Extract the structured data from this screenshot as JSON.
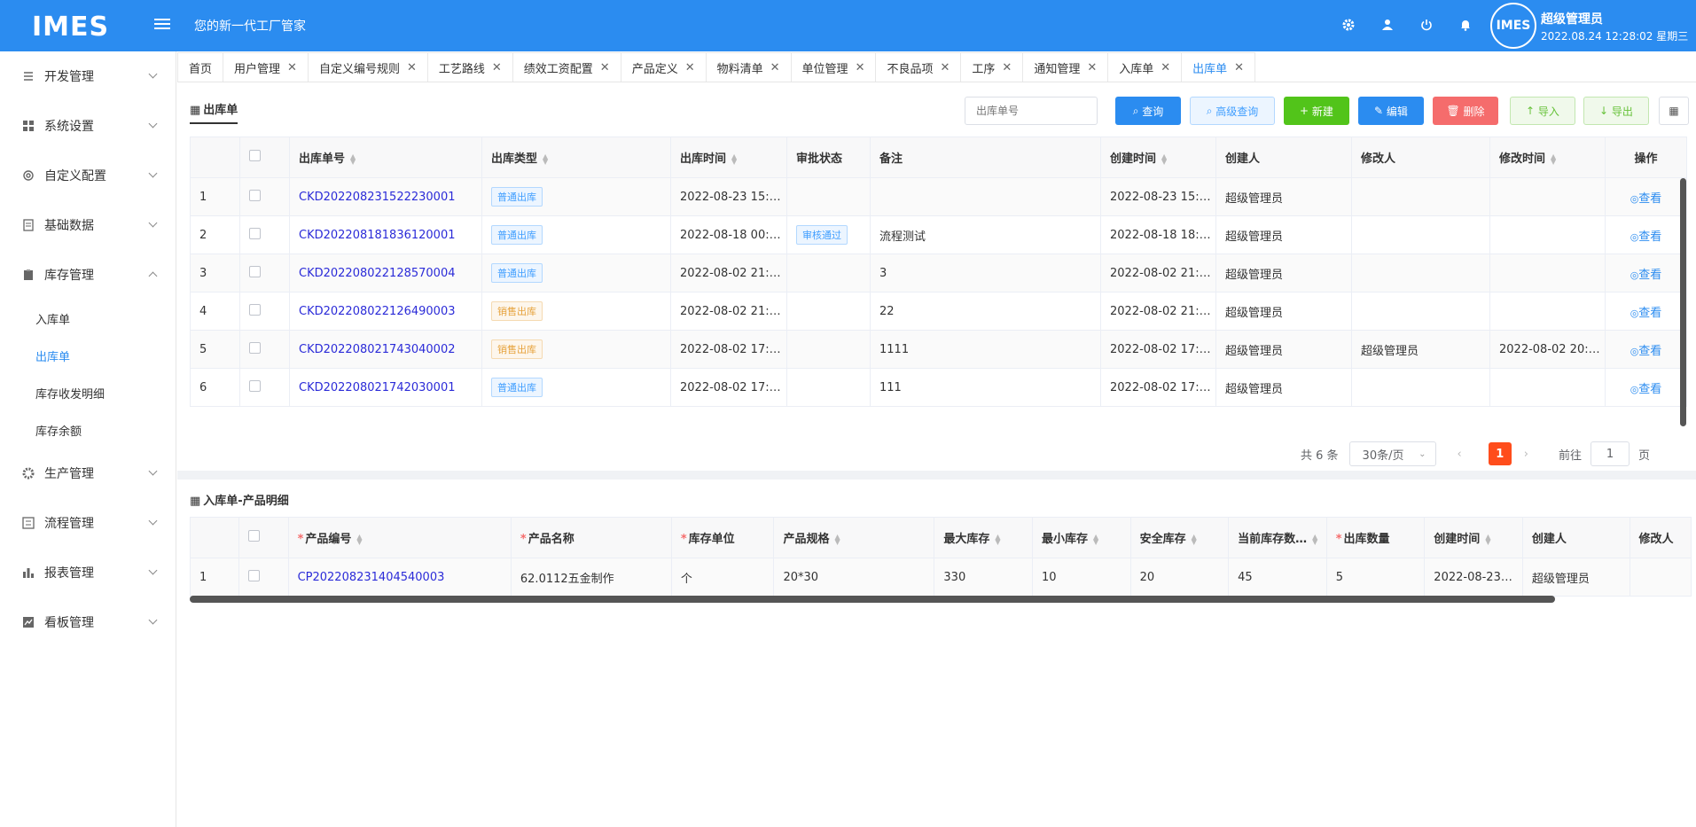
{
  "header": {
    "logo": "IMES",
    "slogan": "您的新一代工厂管家",
    "avatar_text": "IMES",
    "user_name": "超级管理员",
    "datetime": "2022.08.24 12:28:02 星期三"
  },
  "sidebar": {
    "items": [
      {
        "label": "开发管理",
        "icon": "code-icon"
      },
      {
        "label": "系统设置",
        "icon": "grid-icon"
      },
      {
        "label": "自定义配置",
        "icon": "gear-icon"
      },
      {
        "label": "基础数据",
        "icon": "document-icon"
      },
      {
        "label": "库存管理",
        "icon": "clipboard-icon"
      },
      {
        "label": "生产管理",
        "icon": "cog-icon"
      },
      {
        "label": "流程管理",
        "icon": "flow-icon"
      },
      {
        "label": "报表管理",
        "icon": "bar-chart-icon"
      },
      {
        "label": "看板管理",
        "icon": "line-chart-icon"
      }
    ],
    "sub_items": [
      "入库单",
      "出库单",
      "库存收发明细",
      "库存余额"
    ],
    "active_sub": "出库单"
  },
  "tabs": [
    "首页",
    "用户管理",
    "自定义编号规则",
    "工艺路线",
    "绩效工资配置",
    "产品定义",
    "物料清单",
    "单位管理",
    "不良品项",
    "工序",
    "通知管理",
    "入库单",
    "出库单"
  ],
  "main": {
    "title": "出库单",
    "search_placeholder": "出库单号",
    "buttons": {
      "query": "查询",
      "advanced": "高级查询",
      "new": "新建",
      "edit": "编辑",
      "delete": "删除",
      "import": "导入",
      "export": "导出"
    },
    "columns": [
      "出库单号",
      "出库类型",
      "出库时间",
      "审批状态",
      "备注",
      "创建时间",
      "创建人",
      "修改人",
      "修改时间",
      "操作"
    ],
    "rows": [
      {
        "idx": "1",
        "code": "CKD202208231522230001",
        "type": "普通出库",
        "type_color": "blue",
        "time": "2022-08-23 15:…",
        "status": "",
        "remark": "",
        "created": "2022-08-23 15:…",
        "creator": "超级管理员",
        "modifier": "",
        "modified": "",
        "action": "查看"
      },
      {
        "idx": "2",
        "code": "CKD202208181836120001",
        "type": "普通出库",
        "type_color": "blue",
        "time": "2022-08-18 00:…",
        "status": "审核通过",
        "remark": "流程测试",
        "created": "2022-08-18 18:…",
        "creator": "超级管理员",
        "modifier": "",
        "modified": "",
        "action": "查看"
      },
      {
        "idx": "3",
        "code": "CKD202208022128570004",
        "type": "普通出库",
        "type_color": "blue",
        "time": "2022-08-02 21:…",
        "status": "",
        "remark": "3",
        "created": "2022-08-02 21:…",
        "creator": "超级管理员",
        "modifier": "",
        "modified": "",
        "action": "查看"
      },
      {
        "idx": "4",
        "code": "CKD202208022126490003",
        "type": "销售出库",
        "type_color": "orange",
        "time": "2022-08-02 21:…",
        "status": "",
        "remark": "22",
        "created": "2022-08-02 21:…",
        "creator": "超级管理员",
        "modifier": "",
        "modified": "",
        "action": "查看"
      },
      {
        "idx": "5",
        "code": "CKD202208021743040002",
        "type": "销售出库",
        "type_color": "orange",
        "time": "2022-08-02 17:…",
        "status": "",
        "remark": "1111",
        "created": "2022-08-02 17:…",
        "creator": "超级管理员",
        "modifier": "超级管理员",
        "modified": "2022-08-02 20:…",
        "action": "查看"
      },
      {
        "idx": "6",
        "code": "CKD202208021742030001",
        "type": "普通出库",
        "type_color": "blue",
        "time": "2022-08-02 17:…",
        "status": "",
        "remark": "111",
        "created": "2022-08-02 17:…",
        "creator": "超级管理员",
        "modifier": "",
        "modified": "",
        "action": "查看"
      }
    ],
    "pagination": {
      "total": "共 6 条",
      "page_size": "30条/页",
      "current": "1",
      "goto_label": "前往",
      "goto_value": "1",
      "page_suffix": "页"
    }
  },
  "detail": {
    "title": "入库单-产品明细",
    "columns": [
      {
        "label": "产品编号",
        "required": true
      },
      {
        "label": "产品名称",
        "required": true
      },
      {
        "label": "库存单位",
        "required": true
      },
      {
        "label": "产品规格",
        "required": false
      },
      {
        "label": "最大库存",
        "required": false
      },
      {
        "label": "最小库存",
        "required": false
      },
      {
        "label": "安全库存",
        "required": false
      },
      {
        "label": "当前库存数…",
        "required": false
      },
      {
        "label": "出库数量",
        "required": true
      },
      {
        "label": "创建时间",
        "required": false
      },
      {
        "label": "创建人",
        "required": false
      },
      {
        "label": "修改人",
        "required": false
      }
    ],
    "rows": [
      {
        "idx": "1",
        "code": "CP202208231404540003",
        "name": "62.0112五金制作",
        "unit": "个",
        "spec": "20*30",
        "max": "330",
        "min": "10",
        "safe": "20",
        "current": "45",
        "qty": "5",
        "created": "2022-08-23…",
        "creator": "超级管理员",
        "modifier": ""
      }
    ]
  }
}
